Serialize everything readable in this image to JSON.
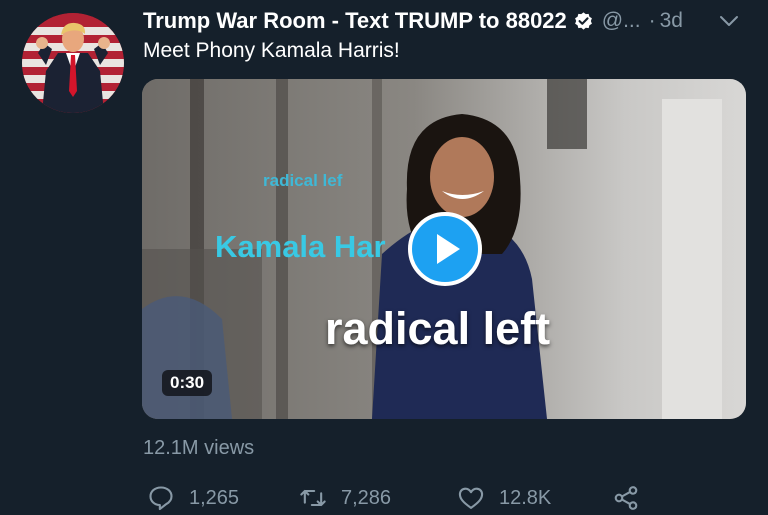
{
  "tweet": {
    "display_name": "Trump War Room - Text TRUMP to 88022",
    "handle": "@...",
    "separator": "·",
    "time": "3d",
    "text": "Meet Phony Kamala Harris!",
    "views": "12.1M views"
  },
  "media": {
    "overlay_small": "radical lef",
    "overlay_medium": "Kamala Har",
    "overlay_large": "radical left",
    "duration": "0:30"
  },
  "actions": {
    "replies": "1,265",
    "retweets": "7,286",
    "likes": "12.8K"
  },
  "colors": {
    "background": "#15202b",
    "secondary_text": "#8899a6",
    "accent": "#1da1f2"
  },
  "icons": [
    "verified-icon",
    "chevron-down-icon",
    "play-icon",
    "reply-icon",
    "retweet-icon",
    "like-icon",
    "share-icon"
  ]
}
